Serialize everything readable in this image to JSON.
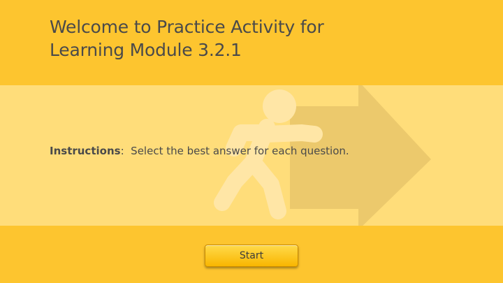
{
  "header": {
    "title": "Welcome to Practice Activity for\nLearning Module 3.2.1"
  },
  "instructions": {
    "label": "Instructions",
    "separator": ":",
    "text": "Select the best answer for each question."
  },
  "start_button": {
    "label": "Start"
  },
  "illustration": {
    "icons": [
      "running-figure-icon",
      "arrow-right-icon"
    ]
  },
  "colors": {
    "background": "#FDC52F",
    "band": "#FFDD7A",
    "arrow": "#E9C56A",
    "figure": "#FFE6A6",
    "text": "#4A4A4A",
    "button_top": "#FFDA4A",
    "button_bottom": "#F9B600"
  }
}
